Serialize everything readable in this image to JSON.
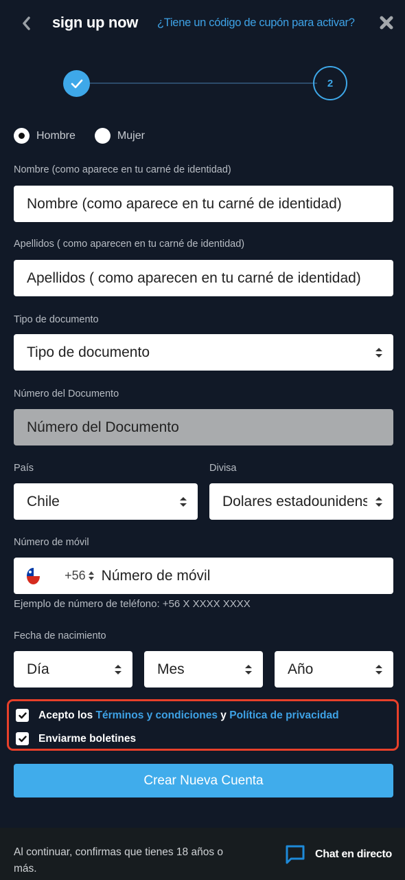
{
  "header": {
    "title": "sign up now",
    "coupon_link": "¿Tiene un código de cupón para activar?"
  },
  "stepper": {
    "current_step": 2,
    "total_steps": 2,
    "step2_label": "2"
  },
  "gender": {
    "options": [
      {
        "label": "Hombre",
        "selected": true
      },
      {
        "label": "Mujer",
        "selected": false
      }
    ]
  },
  "form": {
    "first_name": {
      "label": "Nombre (como aparece en tu carné de identidad)",
      "placeholder": "Nombre (como aparece en tu carné de identidad)",
      "value": ""
    },
    "last_name": {
      "label": "Apellidos ( como aparecen en tu carné de identidad)",
      "placeholder": "Apellidos ( como aparecen en tu carné de identidad)",
      "value": ""
    },
    "document_type": {
      "label": "Tipo de documento",
      "selected": "Tipo de documento"
    },
    "document_number": {
      "label": "Número del Documento",
      "placeholder": "Número del Documento",
      "value": ""
    },
    "country": {
      "label": "País",
      "selected": "Chile"
    },
    "currency": {
      "label": "Divisa",
      "selected": "Dolares estadounidenses"
    },
    "mobile": {
      "label": "Número de móvil",
      "country_code": "+56",
      "placeholder": "Número de móvil",
      "value": "",
      "hint": "Ejemplo de número de teléfono: +56 X XXXX XXXX"
    },
    "birthdate": {
      "label": "Fecha de nacimiento",
      "day": "Día",
      "month": "Mes",
      "year": "Año"
    }
  },
  "consent": {
    "terms_prefix": "Acepto los",
    "terms_link": "Términos y condiciones",
    "terms_joiner": "y",
    "privacy_link": "Política de privacidad",
    "terms_checked": true,
    "newsletter_label": "Enviarme boletines",
    "newsletter_checked": true
  },
  "submit_label": "Crear Nueva Cuenta",
  "footer": {
    "age_notice": "Al continuar, confirmas que tienes 18 años o más.",
    "chat_label": "Chat en directo"
  },
  "colors": {
    "background": "#111927",
    "accent": "#40aceb",
    "link": "#3ea2e6",
    "highlight_border": "#e8402a",
    "footer_bg": "#171c1f"
  }
}
